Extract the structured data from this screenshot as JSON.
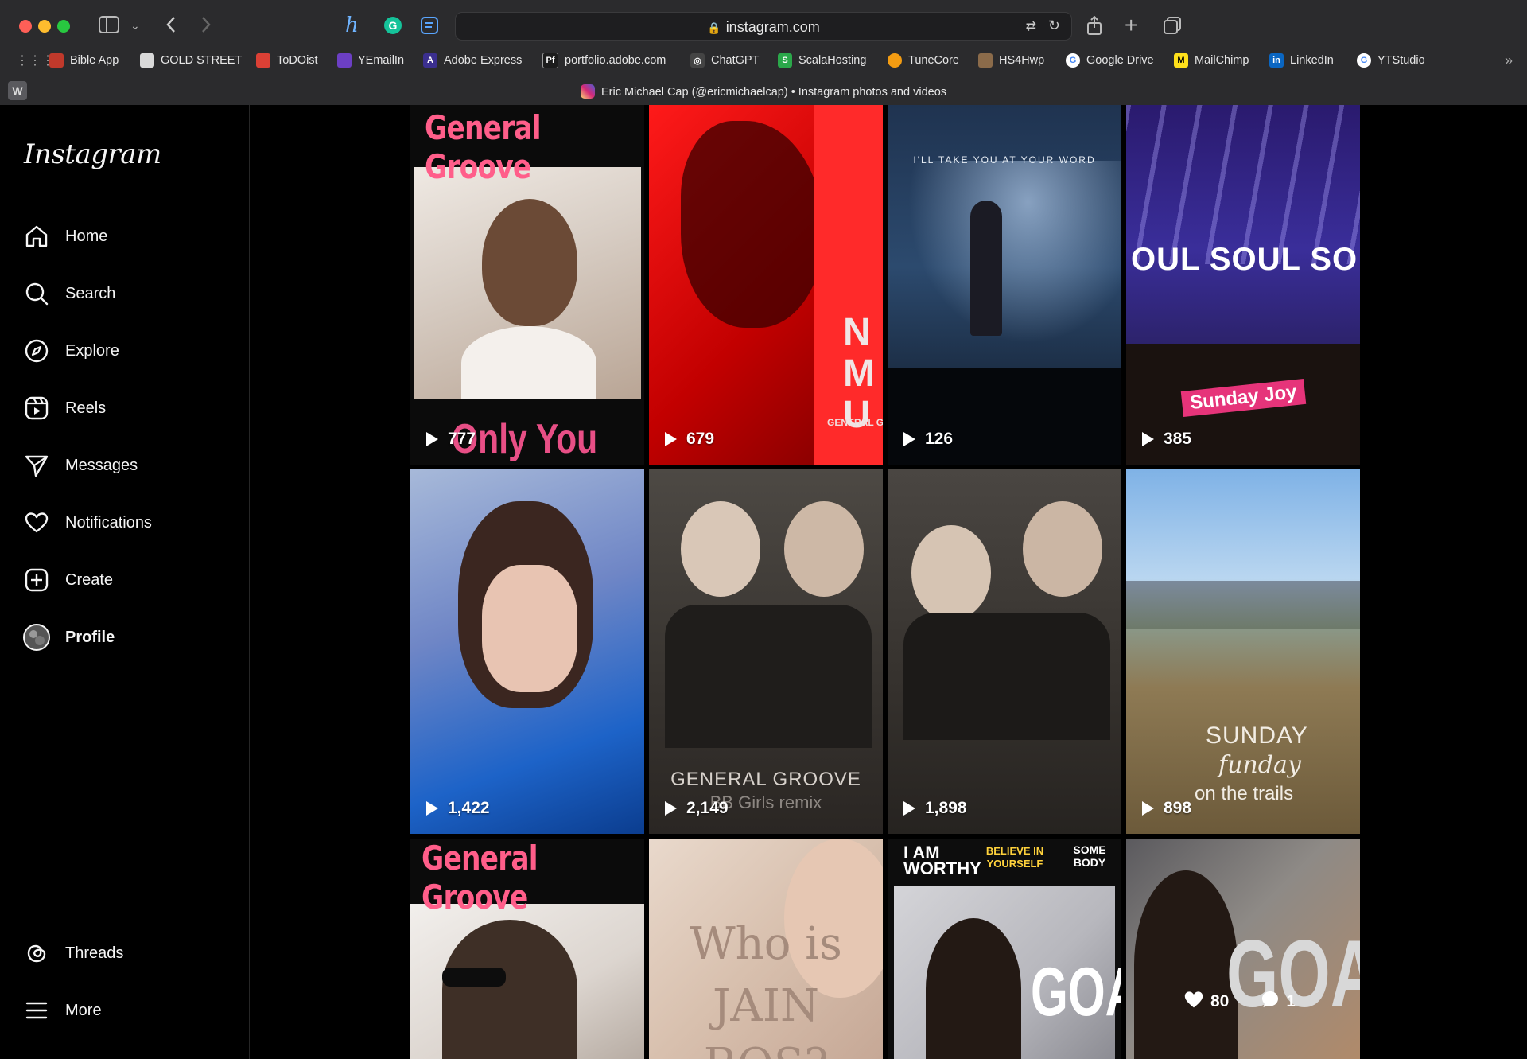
{
  "browser": {
    "url": "instagram.com",
    "tab_title": "Eric Michael Cap (@ericmichaelcap) • Instagram photos and videos",
    "tab_badge": "W",
    "bookmarks": [
      {
        "label": "Bible App",
        "color": "#c0392b"
      },
      {
        "label": "GOLD STREET",
        "color": "#d9d9d9"
      },
      {
        "label": "ToDOist",
        "color": "#db4035"
      },
      {
        "label": "YEmailIn",
        "color": "#6c3fc4"
      },
      {
        "label": "Adobe Express",
        "color": "#3b2f8f"
      },
      {
        "label": "portfolio.adobe.com",
        "color": "#1c1c1c"
      },
      {
        "label": "ChatGPT",
        "color": "#444444"
      },
      {
        "label": "ScalaHosting",
        "color": "#2ba84a"
      },
      {
        "label": "TuneCore",
        "color": "#f39c12"
      },
      {
        "label": "HS4Hwp",
        "color": "#8b6b4a"
      },
      {
        "label": "Google Drive",
        "color": "#4285f4"
      },
      {
        "label": "MailChimp",
        "color": "#ffe01b"
      },
      {
        "label": "LinkedIn",
        "color": "#0a66c2"
      },
      {
        "label": "YTStudio",
        "color": "#4285f4"
      }
    ]
  },
  "sidebar": {
    "logo": "Instagram",
    "items": [
      {
        "label": "Home",
        "icon": "home-icon"
      },
      {
        "label": "Search",
        "icon": "search-icon"
      },
      {
        "label": "Explore",
        "icon": "compass-icon"
      },
      {
        "label": "Reels",
        "icon": "reels-icon"
      },
      {
        "label": "Messages",
        "icon": "messages-icon"
      },
      {
        "label": "Notifications",
        "icon": "heart-icon"
      },
      {
        "label": "Create",
        "icon": "plus-square-icon"
      },
      {
        "label": "Profile",
        "icon": "avatar"
      }
    ],
    "bottom": [
      {
        "label": "Threads",
        "icon": "threads-icon"
      },
      {
        "label": "More",
        "icon": "menu-icon"
      }
    ]
  },
  "posts": [
    {
      "views": "777",
      "overlay_top": "General Groove",
      "overlay_bottom": "Only You"
    },
    {
      "views": "679",
      "overlay_side": "N MU",
      "overlay_small": "GENERAL GRO"
    },
    {
      "views": "126",
      "overlay_top": "I'LL TAKE YOU AT YOUR WORD"
    },
    {
      "views": "385",
      "overlay_banner": "OUL SOUL SO",
      "overlay_sticker": "Sunday Joy"
    },
    {
      "views": "1,422"
    },
    {
      "views": "2,149",
      "overlay_text": "GENERAL GROOVE",
      "overlay_sub": "BB Girls remix"
    },
    {
      "views": "1,898"
    },
    {
      "views": "898",
      "overlay_text": "SUNDAY",
      "overlay_script": "funday",
      "overlay_sub": "on the trails"
    },
    {
      "overlay_top": "General Groove"
    },
    {
      "overlay_text": "Who is",
      "overlay_sub": "JAIN",
      "overlay_more": "ROS?"
    },
    {
      "overlay_top": "I AM WORTHY",
      "overlay_mid": "BELIEVE IN YOURSELF",
      "overlay_right": "SOME BODY",
      "overlay_big": "GOA"
    },
    {
      "overlay_big": "GOA",
      "likes": "80",
      "comments": "1"
    }
  ]
}
